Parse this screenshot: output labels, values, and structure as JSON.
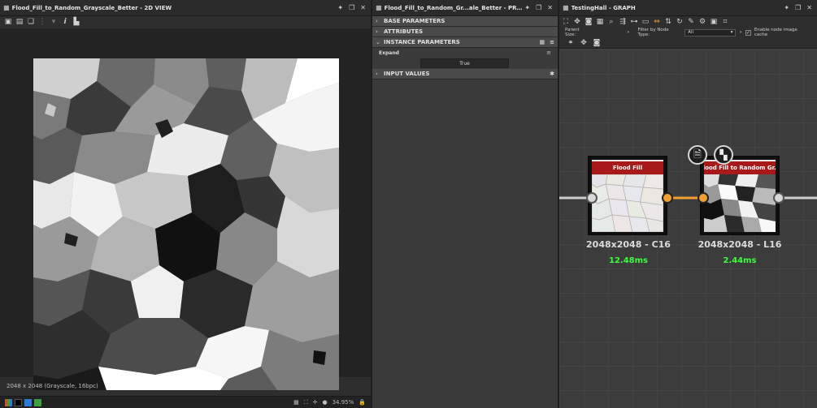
{
  "view2d": {
    "title": "Flood_Fill_to_Random_Grayscale_Better - 2D VIEW",
    "info": "2048 x 2048 (Grayscale, 16bpc)",
    "zoom": "34.95%",
    "toolbar_icons": [
      "save-icon",
      "floppy-icon",
      "copy-icon",
      "channels-icon",
      "info-icon",
      "histogram-icon"
    ],
    "status_swatches": [
      "#d94b2b",
      "#000000",
      "#2b7bd9",
      "#3fa03f"
    ]
  },
  "properties": {
    "title": "Flood_Fill_to_Random_Gr...ale_Better - PROPERTIES",
    "sections": {
      "base": "BASE PARAMETERS",
      "attributes": "ATTRIBUTES",
      "instance": "INSTANCE PARAMETERS",
      "input": "INPUT VALUES"
    },
    "expand_label": "Expand",
    "expand_value": "True"
  },
  "graph": {
    "title": "TestingHall - GRAPH",
    "parent_size_label": "Parent Size:",
    "filter_label": "Filter by Node Type:",
    "filter_value": "All",
    "enable_cache_label": "Enable node image cache",
    "nodes": [
      {
        "name": "Flood Fill",
        "resolution": "2048x2048 - C16",
        "time": "12.48ms"
      },
      {
        "name": "Flood Fill to Random Gr...",
        "resolution": "2048x2048 - L16",
        "time": "2.44ms"
      }
    ],
    "accent": "#f0a030",
    "header_color": "#a81a1a",
    "time_color": "#3cff3c"
  }
}
